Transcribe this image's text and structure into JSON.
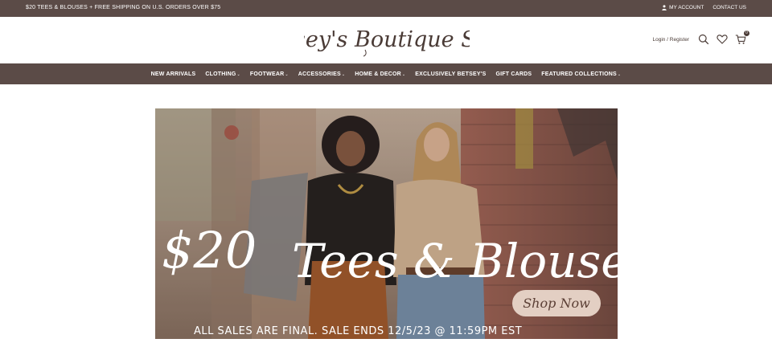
{
  "announcement": {
    "promo": "$20 TEES & BLOUSES + FREE SHIPPING ON U.S. ORDERS OVER $75",
    "my_account": "MY ACCOUNT",
    "contact_us": "CONTACT US"
  },
  "header": {
    "logo_text": "Betsey's Boutique Shop",
    "login_register": "Login / Register",
    "cart_count": "0"
  },
  "nav": {
    "items": [
      {
        "label": "NEW ARRIVALS",
        "has_dropdown": false
      },
      {
        "label": "CLOTHING",
        "has_dropdown": true
      },
      {
        "label": "FOOTWEAR",
        "has_dropdown": true
      },
      {
        "label": "ACCESSORIES",
        "has_dropdown": true
      },
      {
        "label": "HOME & DECOR",
        "has_dropdown": true
      },
      {
        "label": "EXCLUSIVELY BETSEY'S",
        "has_dropdown": false
      },
      {
        "label": "GIFT CARDS",
        "has_dropdown": false
      },
      {
        "label": "FEATURED COLLECTIONS",
        "has_dropdown": true
      }
    ],
    "caret": "⌄"
  },
  "banner": {
    "headline_price": "$20",
    "headline_text": "Tees & Blouses",
    "cta": "Shop Now",
    "footer_text": "ALL SALES ARE FINAL.  SALE ENDS 12/5/23 @ 11:59PM EST"
  },
  "colors": {
    "bar_brown": "#5b4b47",
    "logo_brown": "#4a3b36",
    "cta_bg": "#e3cfc3"
  }
}
